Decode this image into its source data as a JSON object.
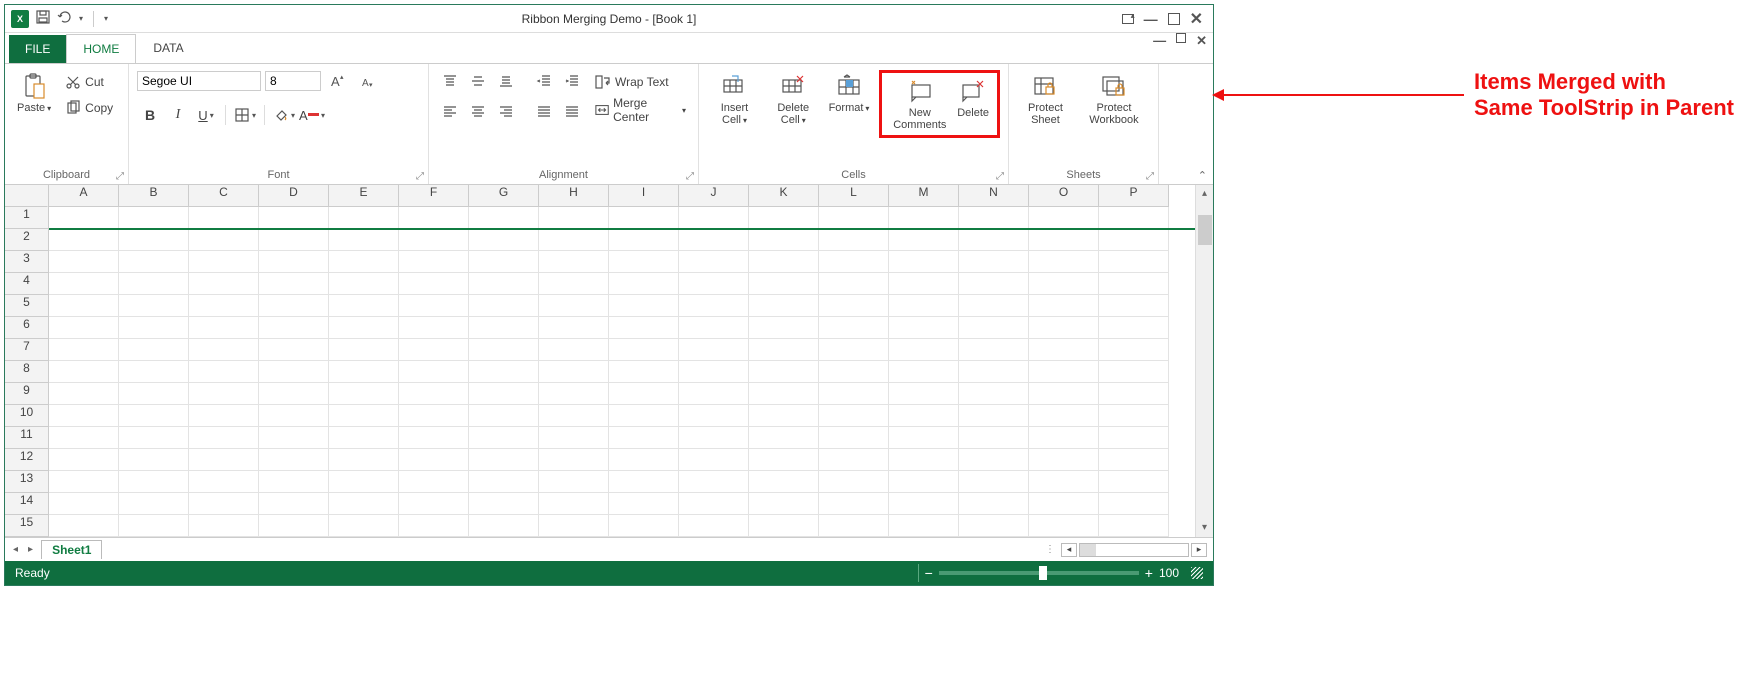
{
  "window": {
    "title": "Ribbon Merging Demo - [Book 1]"
  },
  "tabs": {
    "file": "FILE",
    "home": "HOME",
    "data": "DATA"
  },
  "clipboard": {
    "paste": "Paste",
    "cut": "Cut",
    "copy": "Copy",
    "label": "Clipboard"
  },
  "font": {
    "name": "Segoe UI",
    "size": "8",
    "label": "Font"
  },
  "alignment": {
    "wrap": "Wrap Text",
    "merge": "Merge  Center",
    "label": "Alignment"
  },
  "cells": {
    "insert": "Insert Cell",
    "delete": "Delete Cell",
    "format": "Format",
    "newComments": "New Comments",
    "del2": "Delete",
    "label": "Cells"
  },
  "sheets": {
    "protectSheet": "Protect Sheet",
    "protectWorkbook": "Protect Workbook",
    "label": "Sheets"
  },
  "columns": [
    "A",
    "B",
    "C",
    "D",
    "E",
    "F",
    "G",
    "H",
    "I",
    "J",
    "K",
    "L",
    "M",
    "N",
    "O",
    "P"
  ],
  "rows": [
    "1",
    "2",
    "3",
    "4",
    "5",
    "6",
    "7",
    "8",
    "9",
    "10",
    "11",
    "12",
    "13",
    "14",
    "15"
  ],
  "sheetTab": "Sheet1",
  "status": {
    "ready": "Ready",
    "zoom": "100"
  },
  "annotation": {
    "line1": "Items Merged with",
    "line2": "Same ToolStrip in Parent"
  }
}
